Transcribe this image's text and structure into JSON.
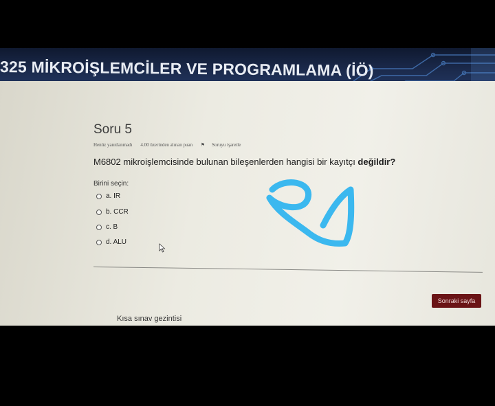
{
  "header": {
    "course_title": "325 MİKROİŞLEMCİLER VE PROGRAMLAMA (İÖ)"
  },
  "question": {
    "title": "Soru 5",
    "status": "Henüz yanıtlanmadı",
    "points": "4.00 üzerinden alınan puan",
    "flag_label": "Soruyu işaretle",
    "text_main": "M6802 mikroişlemcisinde bulunan bileşenlerden hangisi bir kayıtçı ",
    "text_emphasis": "değildir?",
    "prompt": "Birini seçin:",
    "options": [
      {
        "label": "a. IR"
      },
      {
        "label": "b. CCR"
      },
      {
        "label": "c. B"
      },
      {
        "label": "d. ALU"
      }
    ]
  },
  "navigation": {
    "next_label": "Sonraki sayfa",
    "quiz_nav_label": "Kısa sınav gezintisi"
  },
  "colors": {
    "banner": "#1b2a4c",
    "next_button": "#6a1416",
    "scribble": "#3bb8ef"
  }
}
